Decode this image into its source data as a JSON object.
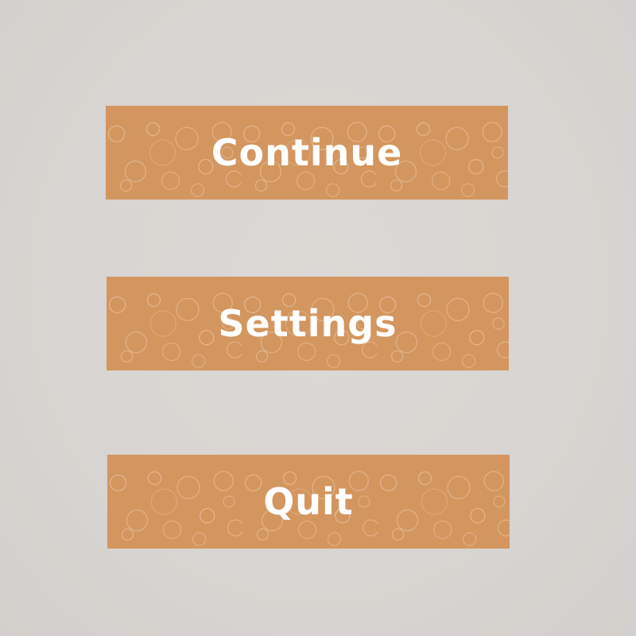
{
  "menu": {
    "buttons": [
      {
        "label": "Continue"
      },
      {
        "label": "Settings"
      },
      {
        "label": "Quit"
      }
    ]
  },
  "colors": {
    "background": "#d8d4d1",
    "button": "#d3965f",
    "button_text": "#ffffff"
  }
}
